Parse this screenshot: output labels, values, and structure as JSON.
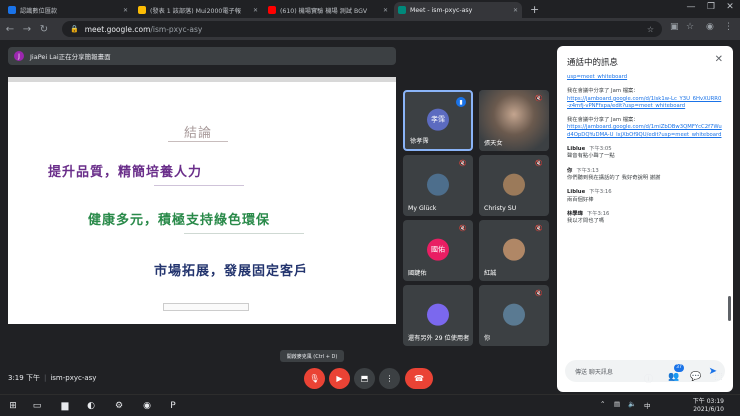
{
  "browser": {
    "tabs": [
      {
        "label": "認識數位匯款",
        "favicon_color": "#1a73e8",
        "active": false
      },
      {
        "label": "(發表 1 該部落) Mui2000電子報",
        "favicon_color": "#fbbc04",
        "active": false
      },
      {
        "label": "(610) 機場實驗 機場 測試 BGV",
        "favicon_color": "#ff0000",
        "active": false
      },
      {
        "label": "Meet - ism-pxyc-asy",
        "favicon_color": "#00897b",
        "active": true
      }
    ],
    "url_host": "meet.google.com",
    "url_path": "/ism-pxyc-asy"
  },
  "meet": {
    "presenting_banner": "JiaPei Lai正在分享簡報畫面",
    "presenter_initial": "J",
    "slide": {
      "title": "結論",
      "line1": "提升品質，精簡培養人力",
      "line2": "健康多元，積極支持綠色環保",
      "line3": "市場拓展，發展固定客戶"
    },
    "tiles": [
      {
        "name": "徐孝霈",
        "initials": "孝霈",
        "color": "#5c6bc0",
        "active": true
      },
      {
        "name": "張天女",
        "initials": "",
        "color": "#6b5a4e",
        "active": false
      },
      {
        "name": "My Glück",
        "initials": "",
        "color": "#4d6e8c",
        "active": false
      },
      {
        "name": "Christy SU",
        "initials": "",
        "color": "#9b7a5a",
        "active": false
      },
      {
        "name": "國鍵佑",
        "initials": "國佑",
        "color": "#e91e63",
        "active": false
      },
      {
        "name": "紅誠",
        "initials": "",
        "color": "#b08766",
        "active": false
      },
      {
        "name": "還有另外 29 位使用者",
        "initials": "",
        "color": "#7b68ee",
        "active": false
      },
      {
        "name": "你",
        "initials": "",
        "color": "#5a7a92",
        "active": false
      }
    ],
    "chat": {
      "title": "通話中的訊息",
      "messages": [
        {
          "who": "",
          "when": "",
          "text": "",
          "link": "usp=meet_whiteboard"
        },
        {
          "who": "",
          "when": "",
          "text": "我在會議中分享了 Jam 檔案：",
          "link": "https://jamboard.google.com/d/1lsk1w-Lc_Y3U_6HvXURR0-z4mfj-vPNFfxpa/edit?usp=meet_whiteboard"
        },
        {
          "who": "",
          "when": "",
          "text": "我在會議中分享了 Jam 檔案：",
          "link": "https://jamboard.google.com/d/1miZbDBw3QMFYcC2f7Wud4OpDQYuDMA-U_lxjXbOf9QU/edit?usp=meet_whiteboard"
        },
        {
          "who": "Liblue",
          "when": "下午3:05",
          "text": "聲音有點小聲了一點",
          "link": ""
        },
        {
          "who": "你",
          "when": "下午3:13",
          "text": "你們聽到我在講話的了 我好奇說明 謝謝",
          "link": ""
        },
        {
          "who": "Liblue",
          "when": "下午3:16",
          "text": "兩百個好棒",
          "link": ""
        },
        {
          "who": "林學瑋",
          "when": "下午3:16",
          "text": "我以才問也了嗎",
          "link": ""
        }
      ],
      "compose_placeholder": "傳送 聊天訊息"
    },
    "tooltip": "開啟麥克風 (Ctrl + D)",
    "time": "3:19 下午",
    "meeting_code": "ism-pxyc-asy",
    "participant_count": "37"
  },
  "taskbar": {
    "time": "下午 03:19",
    "date": "2021/6/10",
    "ime": "中"
  }
}
